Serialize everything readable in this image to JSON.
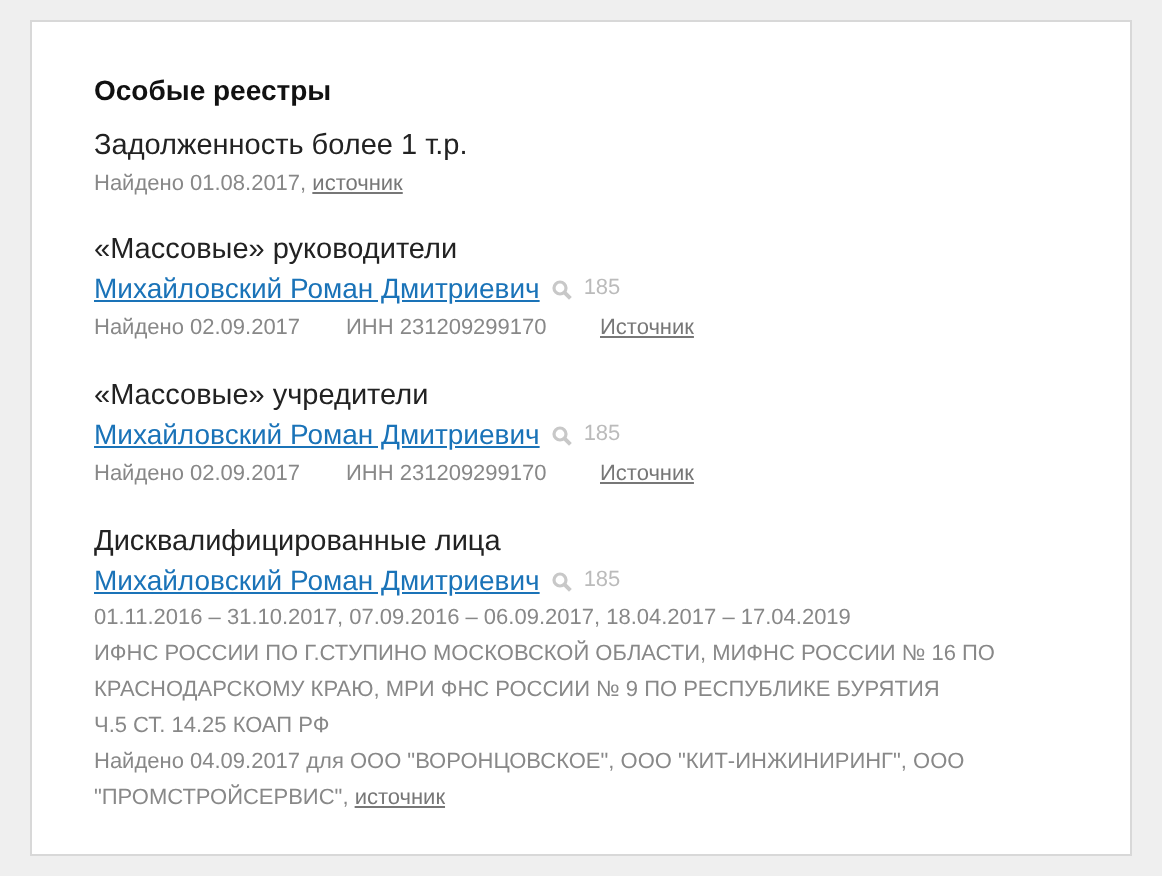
{
  "title": "Особые реестры",
  "sections": [
    {
      "heading": "Задолженность более 1 т.р.",
      "found": {
        "text": "Найдено 01.08.2017,",
        "link": "источник"
      }
    },
    {
      "heading": "«Массовые» руководители",
      "person": {
        "name": "Михайловский Роман Дмитриевич",
        "count": "185"
      },
      "details": {
        "found": "Найдено 02.09.2017",
        "inn": "ИНН 231209299170",
        "source": "Источник"
      }
    },
    {
      "heading": "«Массовые» учредители",
      "person": {
        "name": "Михайловский Роман Дмитриевич",
        "count": "185"
      },
      "details": {
        "found": "Найдено 02.09.2017",
        "inn": "ИНН 231209299170",
        "source": "Источник"
      }
    },
    {
      "heading": "Дисквалифицированные лица",
      "person": {
        "name": "Михайловский Роман Дмитриевич",
        "count": "185"
      },
      "lines": [
        "01.11.2016 – 31.10.2017, 07.09.2016 – 06.09.2017, 18.04.2017 – 17.04.2019",
        "ИФНС РОССИИ ПО Г.СТУПИНО МОСКОВСКОЙ ОБЛАСТИ, МИФНС РОССИИ № 16 ПО КРАСНОДАРСКОМУ КРАЮ, МРИ ФНС РОССИИ № 9 ПО РЕСПУБЛИКЕ БУРЯТИЯ",
        "Ч.5 СТ. 14.25 КОАП РФ"
      ],
      "found": {
        "text": "Найдено 04.09.2017 для ООО \"ВОРОНЦОВСКОЕ\", ООО \"КИТ-ИНЖИНИРИНГ\", ООО \"ПРОМСТРОЙСЕРВИС\",",
        "link": "источник"
      }
    }
  ]
}
